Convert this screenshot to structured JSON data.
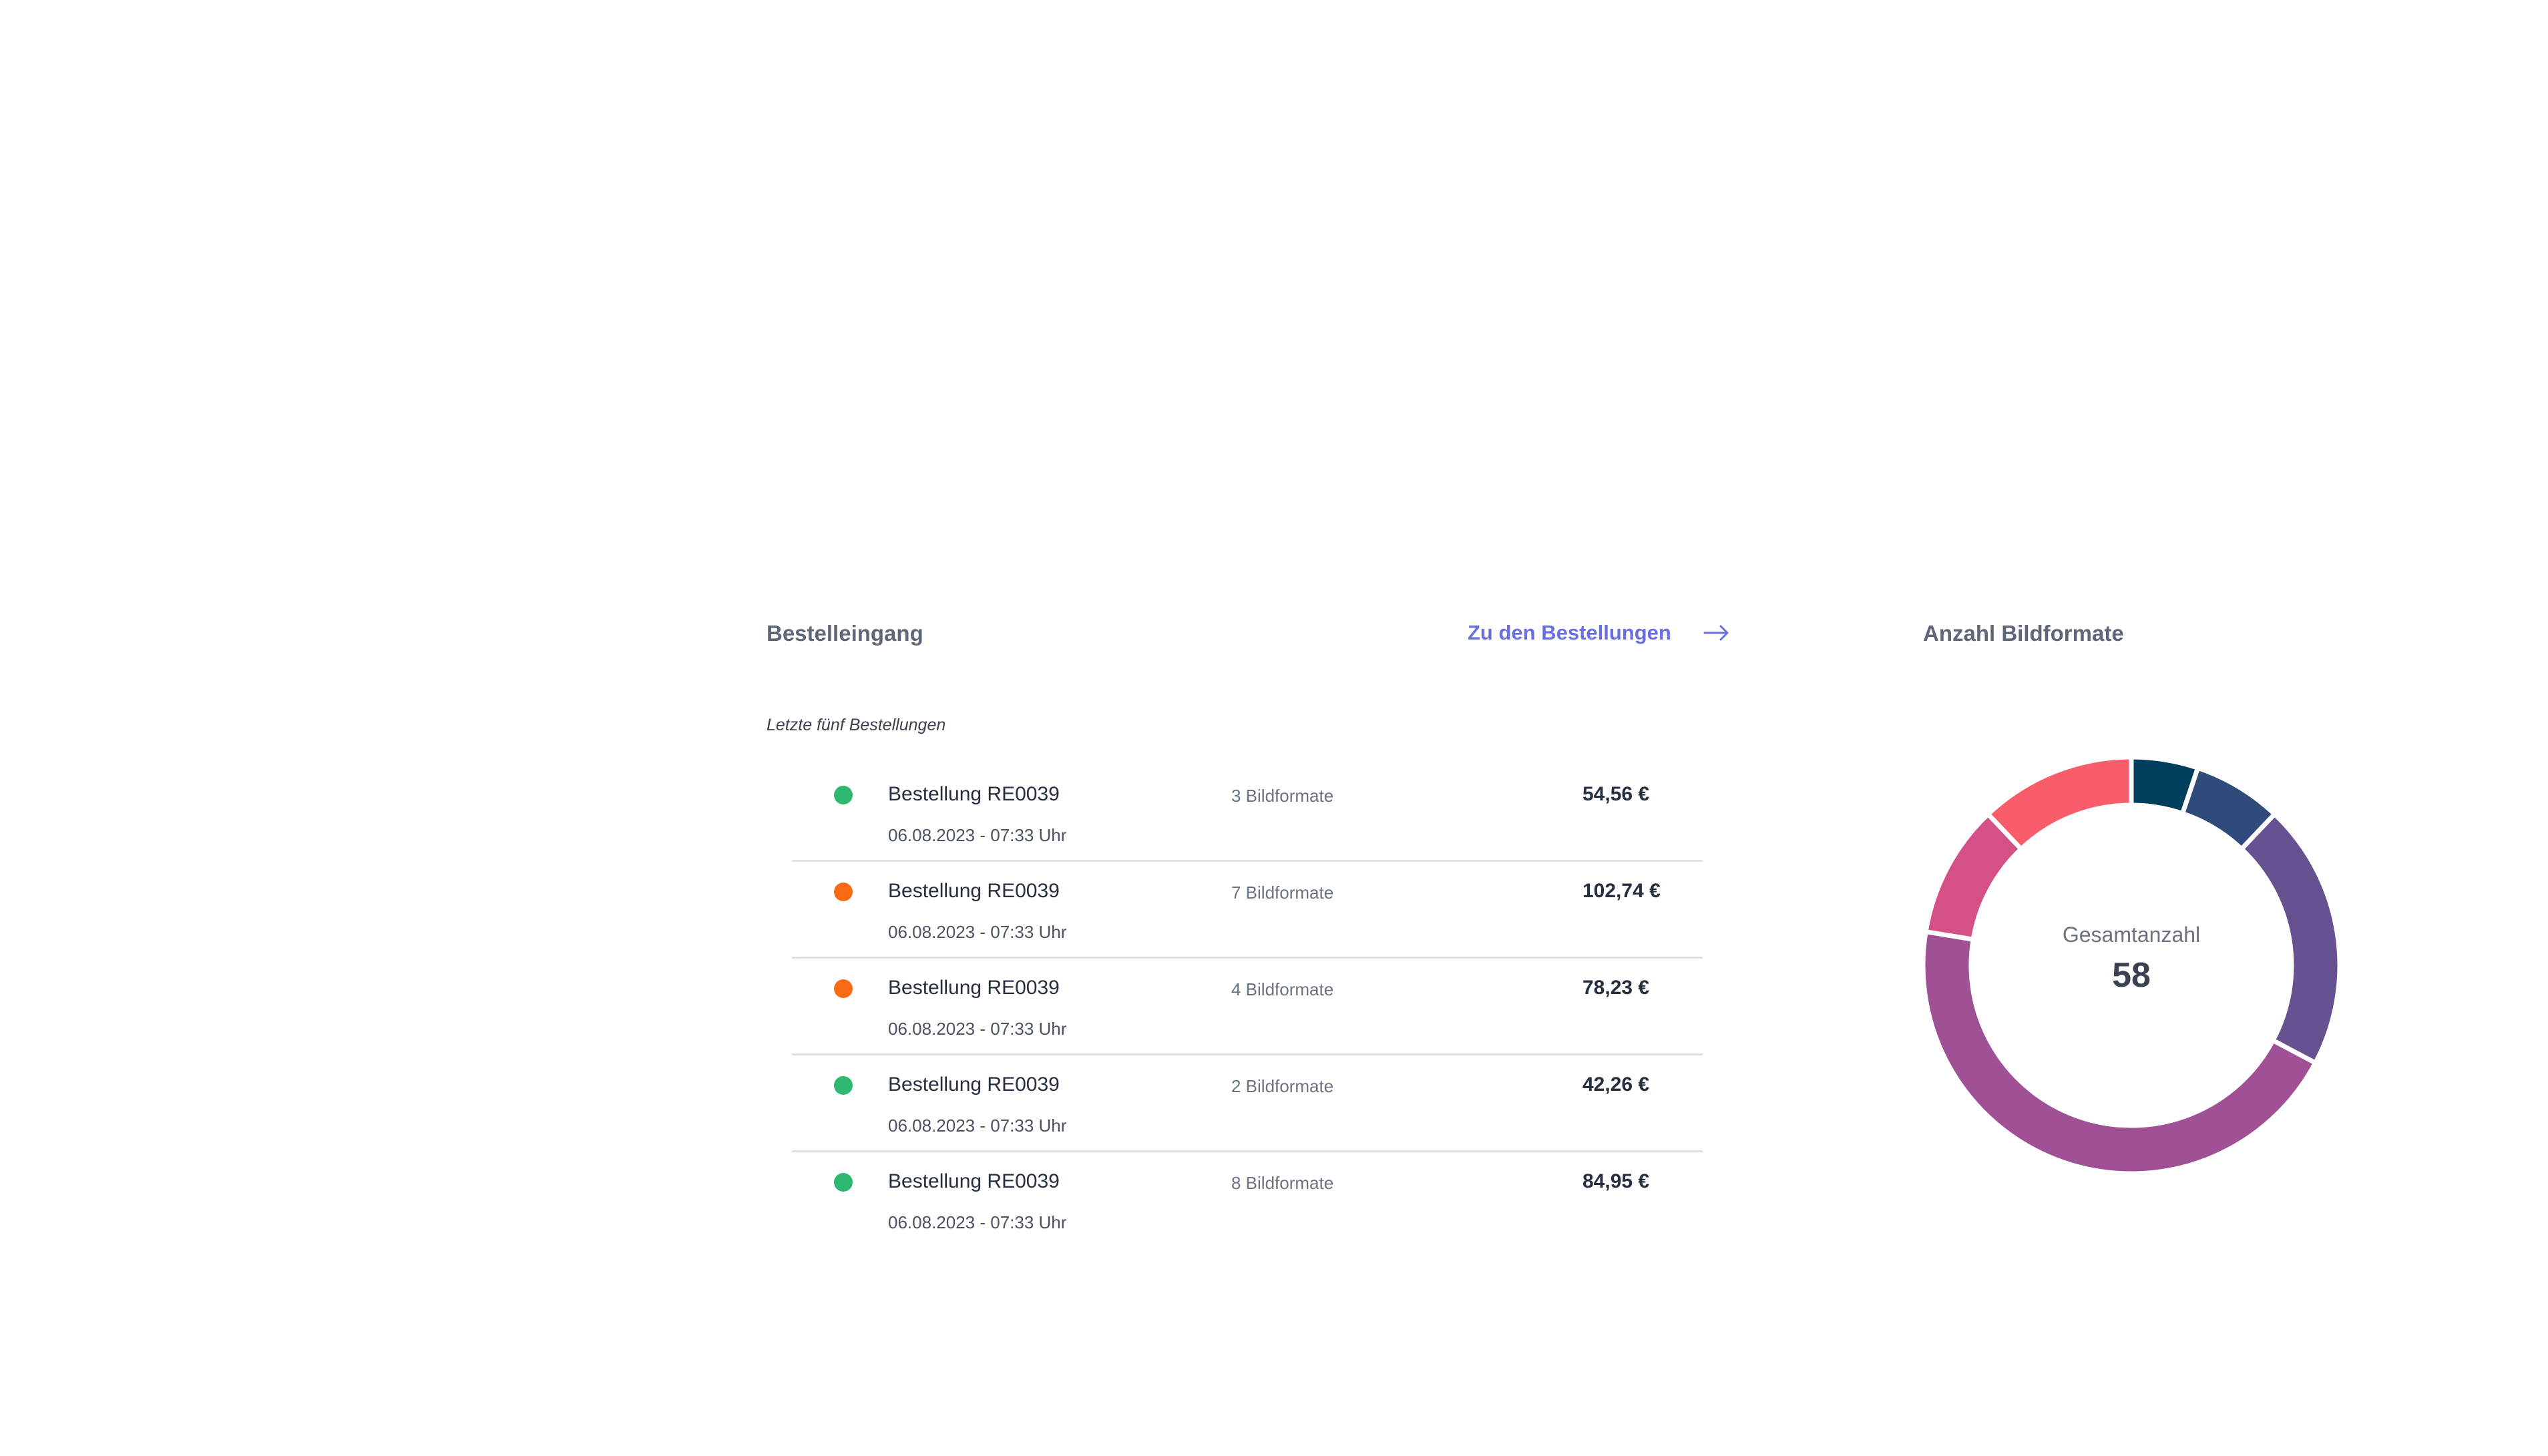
{
  "orders_section": {
    "title": "Bestelleingang",
    "link_label": "Zu den Bestellungen",
    "link_icon": "arrow-right-icon",
    "subtitle": "Letzte fünf Bestellungen",
    "orders": [
      {
        "name": "Bestellung RE0039",
        "date": "06.08.2023 - 07:33 Uhr",
        "formats": "3 Bildformate",
        "price": "54,56 €",
        "status_color": "#2eb872"
      },
      {
        "name": "Bestellung RE0039",
        "date": "06.08.2023 - 07:33 Uhr",
        "formats": "7 Bildformate",
        "price": "102,74 €",
        "status_color": "#f86a14"
      },
      {
        "name": "Bestellung RE0039",
        "date": "06.08.2023 - 07:33 Uhr",
        "formats": "4 Bildformate",
        "price": "78,23 €",
        "status_color": "#f86a14"
      },
      {
        "name": "Bestellung RE0039",
        "date": "06.08.2023 - 07:33 Uhr",
        "formats": "2 Bildformate",
        "price": "42,26 €",
        "status_color": "#2eb872"
      },
      {
        "name": "Bestellung RE0039",
        "date": "06.08.2023 - 07:33 Uhr",
        "formats": "8 Bildformate",
        "price": "84,95 €",
        "status_color": "#2eb872"
      }
    ]
  },
  "formats_section": {
    "title": "Anzahl Bildformate",
    "center_label": "Gesamtanzahl",
    "center_total": "58"
  },
  "chart_data": {
    "type": "pie",
    "variant": "donut",
    "title": "Anzahl Bildformate",
    "total": 58,
    "slices": [
      {
        "value": 3,
        "color": "#003f5c"
      },
      {
        "value": 4,
        "color": "#2f4b7c"
      },
      {
        "value": 12,
        "color": "#665191"
      },
      {
        "value": 26,
        "color": "#a05195"
      },
      {
        "value": 6,
        "color": "#d45087"
      },
      {
        "value": 7,
        "color": "#f95d6a"
      }
    ]
  }
}
